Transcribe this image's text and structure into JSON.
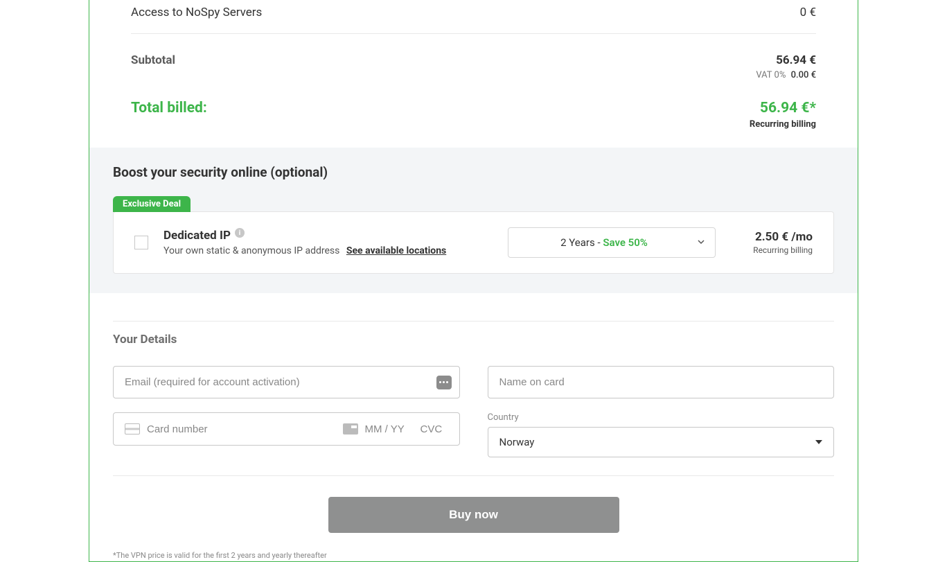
{
  "summary": {
    "nospy_label": "Access to NoSpy Servers",
    "nospy_value": "0 €",
    "subtotal_label": "Subtotal",
    "subtotal_value": "56.94 €",
    "vat_label": "VAT 0%",
    "vat_amount": "0.00 €",
    "total_label": "Total billed:",
    "total_value": "56.94 €*",
    "recurring": "Recurring billing"
  },
  "boost": {
    "heading": "Boost your security online (optional)",
    "badge": "Exclusive Deal",
    "addon_title": "Dedicated IP",
    "addon_desc": "Your own static & anonymous IP address",
    "locations_link": "See available locations",
    "term_prefix": "2 Years",
    "term_dash": " - ",
    "term_save": "Save 50%",
    "price": "2.50 € /mo",
    "price_note": "Recurring billing"
  },
  "details": {
    "heading": "Your Details",
    "email_placeholder": "Email (required for account activation)",
    "name_placeholder": "Name on card",
    "card_placeholder": "Card number",
    "exp_placeholder": "MM / YY",
    "cvc_placeholder": "CVC",
    "country_label": "Country",
    "country_value": "Norway"
  },
  "actions": {
    "buy": "Buy now"
  },
  "fineprint": {
    "line1": "*The VPN price is valid for the first 2 years and yearly thereafter"
  }
}
